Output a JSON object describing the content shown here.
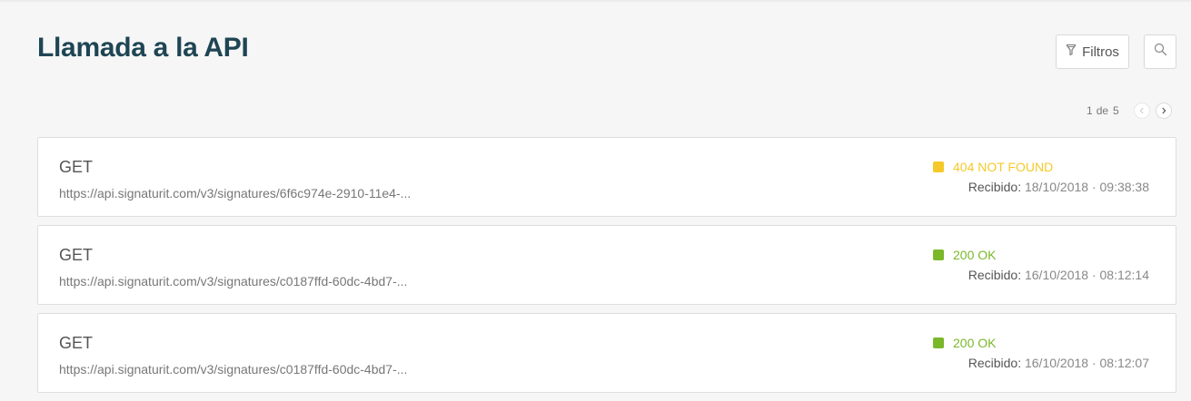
{
  "header": {
    "title": "Llamada a la API",
    "filter_label": "Filtros"
  },
  "pagination": {
    "current": "1",
    "separator": "de",
    "total": "5"
  },
  "colors": {
    "title": "#1f4554",
    "warning": "#f5c92b",
    "success": "#7ab82a"
  },
  "icons": {
    "filter": "funnel-icon",
    "search": "magnifier-icon",
    "prev": "chevron-left-icon",
    "next": "chevron-right-icon"
  },
  "calls": [
    {
      "method": "GET",
      "url": "https://api.signaturit.com/v3/signatures/6f6c974e-2910-11e4-...",
      "status": "404 NOT FOUND",
      "status_color": "#f5c92b",
      "received_label": "Recibido:",
      "received_value": "18/10/2018 · 09:38:38"
    },
    {
      "method": "GET",
      "url": "https://api.signaturit.com/v3/signatures/c0187ffd-60dc-4bd7-...",
      "status": "200 OK",
      "status_color": "#7ab82a",
      "received_label": "Recibido:",
      "received_value": "16/10/2018 · 08:12:14"
    },
    {
      "method": "GET",
      "url": "https://api.signaturit.com/v3/signatures/c0187ffd-60dc-4bd7-...",
      "status": "200 OK",
      "status_color": "#7ab82a",
      "received_label": "Recibido:",
      "received_value": "16/10/2018 · 08:12:07"
    }
  ]
}
